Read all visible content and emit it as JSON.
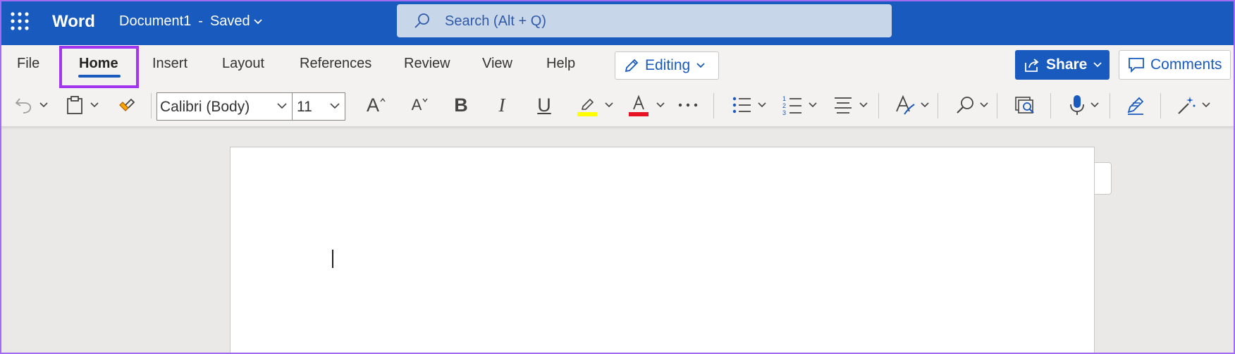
{
  "titlebar": {
    "app_name": "Word",
    "document_name": "Document1",
    "separator": "-",
    "save_status": "Saved",
    "search_placeholder": "Search (Alt + Q)"
  },
  "menu": {
    "tabs": [
      {
        "label": "File"
      },
      {
        "label": "Home",
        "active": true
      },
      {
        "label": "Insert"
      },
      {
        "label": "Layout"
      },
      {
        "label": "References"
      },
      {
        "label": "Review"
      },
      {
        "label": "View"
      },
      {
        "label": "Help"
      }
    ],
    "mode_label": "Editing",
    "share_label": "Share",
    "comments_label": "Comments"
  },
  "toolbar": {
    "font_name": "Calibri (Body)",
    "font_size": "11",
    "bold_glyph": "B",
    "italic_glyph": "I",
    "underline_glyph": "U",
    "grow_glyph": "A",
    "shrink_glyph": "A",
    "highlight_color": "#ffff00",
    "font_color": "#e81123"
  },
  "colors": {
    "brand": "#185abd",
    "highlight_box": "#a235ee",
    "ribbon_bg": "#f3f2f1",
    "canvas_bg": "#eae9e8"
  }
}
